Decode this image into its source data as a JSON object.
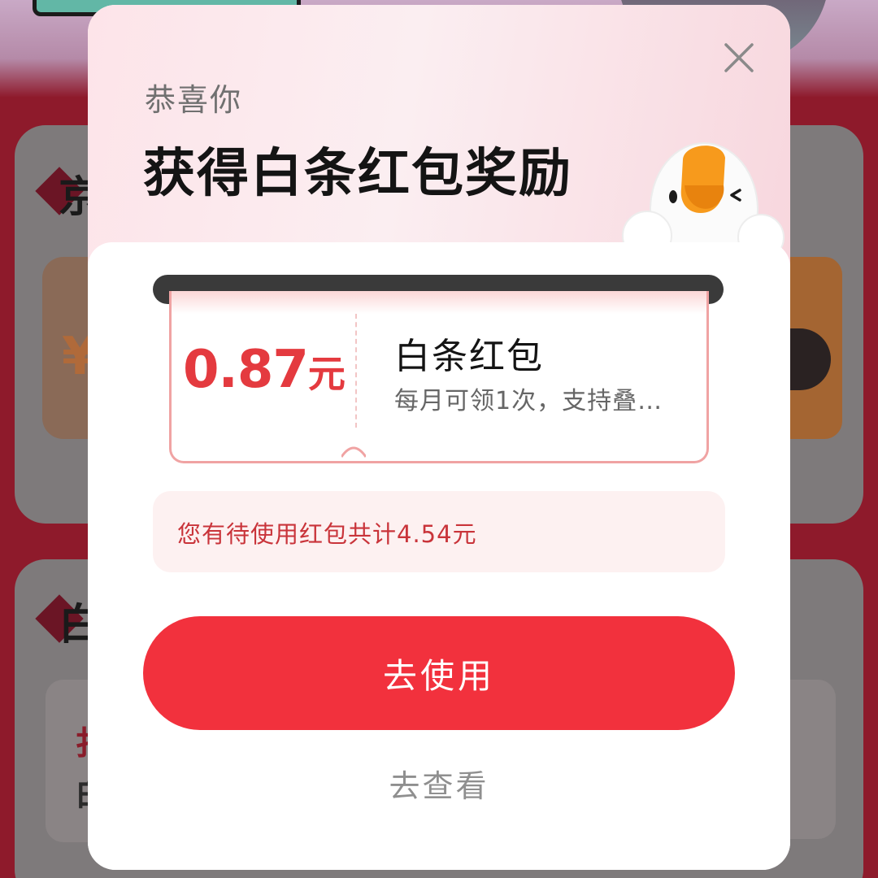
{
  "background": {
    "card1_title_char": "京",
    "card2_title_char": "白",
    "coupon_currency": "¥",
    "inner_char_1": "扌",
    "inner_char_2": "白"
  },
  "modal": {
    "greeting": "恭喜你",
    "headline": "获得白条红包奖励",
    "close_icon": "close-icon",
    "coupon": {
      "amount": "0.87",
      "unit": "元",
      "title": "白条红包",
      "description": "每月可领1次，支持叠…"
    },
    "info_text": "您有待使用红包共计4.54元",
    "primary_button_label": "去使用",
    "secondary_link_label": "去查看"
  },
  "colors": {
    "accent_red": "#f2313d",
    "amount_red": "#e43a3f",
    "info_red": "#c9343a",
    "header_pink": "#fde4e9"
  }
}
